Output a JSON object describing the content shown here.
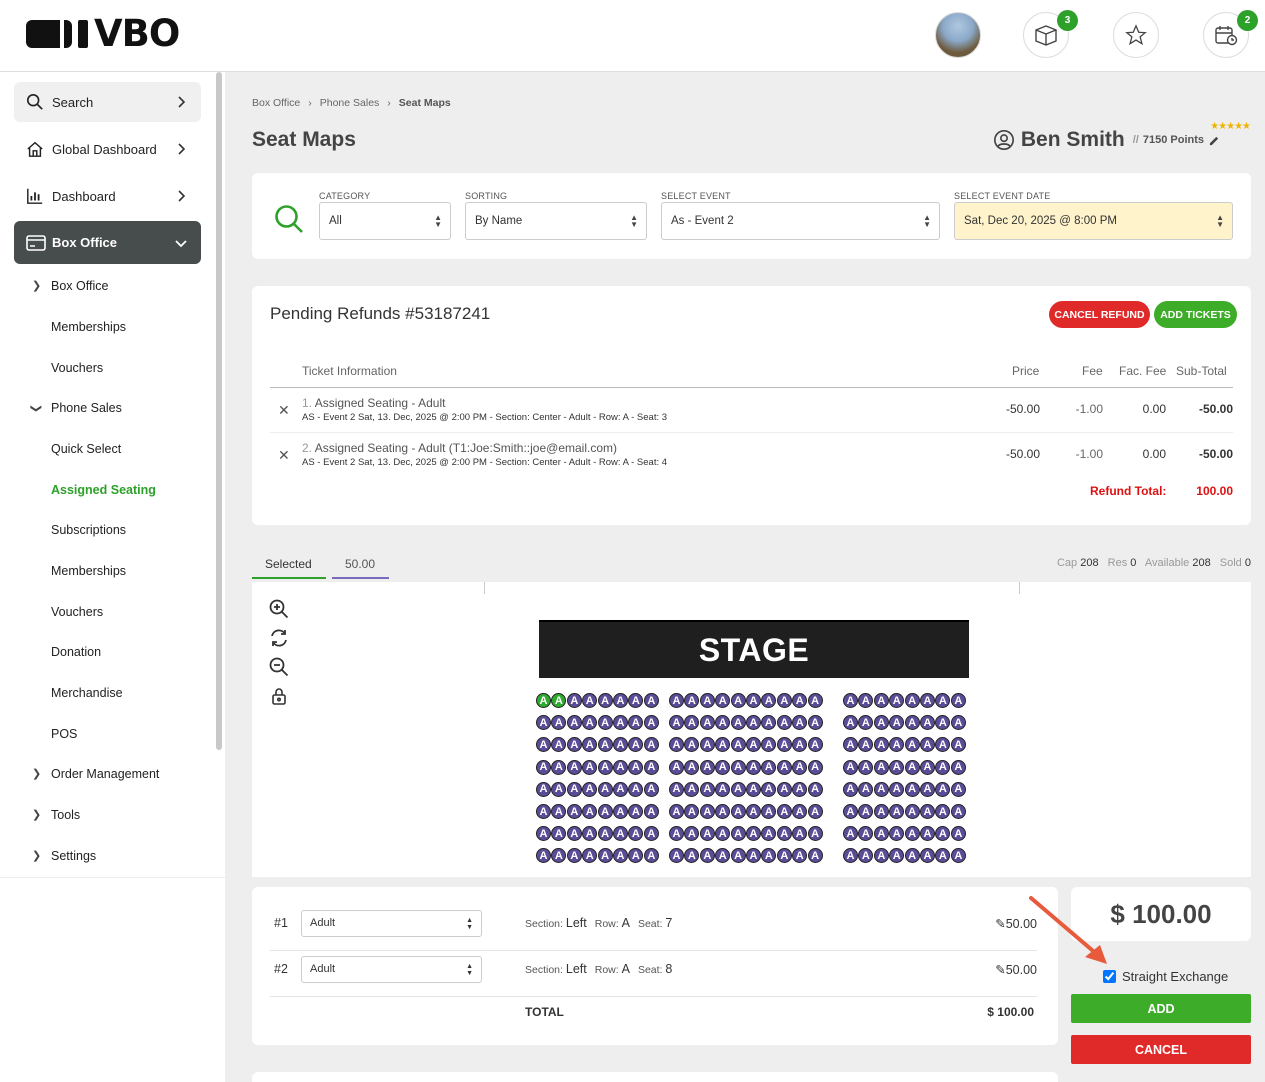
{
  "app": {
    "logo_text": "VBO"
  },
  "topbar": {
    "cart_badge": "3",
    "calendar_badge": "2",
    "icons": [
      "avatar",
      "box-icon",
      "star-icon",
      "calendar-clock-icon"
    ]
  },
  "sidebar": {
    "search_label": "Search",
    "global_dashboard_label": "Global Dashboard",
    "dashboard_label": "Dashboard",
    "box_office_section_label": "Box Office",
    "items": [
      {
        "label": "Box Office",
        "expandable": true
      },
      {
        "label": "Memberships"
      },
      {
        "label": "Vouchers"
      },
      {
        "label": "Phone Sales",
        "expanded": true
      },
      {
        "label": "Quick Select"
      },
      {
        "label": "Assigned Seating",
        "active": true
      },
      {
        "label": "Subscriptions"
      },
      {
        "label": "Memberships"
      },
      {
        "label": "Vouchers"
      },
      {
        "label": "Donation"
      },
      {
        "label": "Merchandise"
      },
      {
        "label": "POS"
      },
      {
        "label": "Order Management",
        "expandable": true
      },
      {
        "label": "Tools",
        "expandable": true
      },
      {
        "label": "Settings",
        "expandable": true
      }
    ]
  },
  "breadcrumb": [
    "Box Office",
    "Phone Sales",
    "Seat Maps"
  ],
  "page": {
    "title": "Seat Maps"
  },
  "user": {
    "name": "Ben Smith",
    "points": "7150 Points",
    "sep": "//",
    "stars": "★★★★★"
  },
  "filters": {
    "category": {
      "label": "CATEGORY",
      "value": "All"
    },
    "sorting": {
      "label": "SORTING",
      "value": "By Name"
    },
    "event": {
      "label": "SELECT EVENT",
      "value": "As - Event 2"
    },
    "date": {
      "label": "SELECT EVENT DATE",
      "value": "Sat, Dec 20, 2025 @ 8:00 PM"
    }
  },
  "refund": {
    "title": "Pending Refunds #53187241",
    "cancel_label": "CANCEL REFUND",
    "add_label": "ADD TICKETS",
    "columns": [
      "Ticket Information",
      "Price",
      "Fee",
      "Fac. Fee",
      "Sub-Total"
    ],
    "rows": [
      {
        "num": "1.",
        "name": "Assigned Seating - Adult",
        "detail": "AS - Event 2 Sat, 13. Dec, 2025 @ 2:00 PM - Section: Center - Adult - Row: A - Seat: 3",
        "price": "-50.00",
        "fee": "-1.00",
        "fac_fee": "0.00",
        "subtotal": "-50.00"
      },
      {
        "num": "2.",
        "name": "Assigned Seating - Adult (T1:Joe:Smith::joe@email.com)",
        "detail": "AS - Event 2 Sat, 13. Dec, 2025 @ 2:00 PM - Section: Center - Adult - Row: A - Seat: 4",
        "price": "-50.00",
        "fee": "-1.00",
        "fac_fee": "0.00",
        "subtotal": "-50.00"
      }
    ],
    "total_label": "Refund Total:",
    "total_value": "100.00"
  },
  "tabs": {
    "selected": "Selected",
    "price": "50.00"
  },
  "capacity": {
    "cap_label": "Cap",
    "cap": "208",
    "res_label": "Res",
    "res": "0",
    "avail_label": "Available",
    "avail": "208",
    "sold_label": "Sold",
    "sold": "0"
  },
  "seatmap": {
    "stage_label": "STAGE",
    "seat_letter": "A",
    "rows": 8,
    "sections": [
      8,
      10,
      8
    ],
    "selected_seats": [
      [
        0,
        0
      ],
      [
        0,
        1
      ]
    ]
  },
  "selection": {
    "rows": [
      {
        "num": "#1",
        "type": "Adult",
        "section_label": "Section:",
        "section": "Left",
        "row_label": "Row:",
        "row": "A",
        "seat_label": "Seat:",
        "seat": "7",
        "price": "50.00"
      },
      {
        "num": "#2",
        "type": "Adult",
        "section_label": "Section:",
        "section": "Left",
        "row_label": "Row:",
        "row": "A",
        "seat_label": "Seat:",
        "seat": "8",
        "price": "50.00"
      }
    ],
    "total_label": "TOTAL",
    "total_value": "$ 100.00"
  },
  "summary": {
    "amount": "$ 100.00",
    "straight_exchange_label": "Straight Exchange",
    "straight_exchange_checked": true,
    "add_label": "ADD",
    "cancel_label": "CANCEL"
  },
  "colors": {
    "accent_green": "#2da12a",
    "danger_red": "#e02a2a",
    "seat_purple": "#5b4c97",
    "sidebar_active_bg": "#474d4c"
  }
}
